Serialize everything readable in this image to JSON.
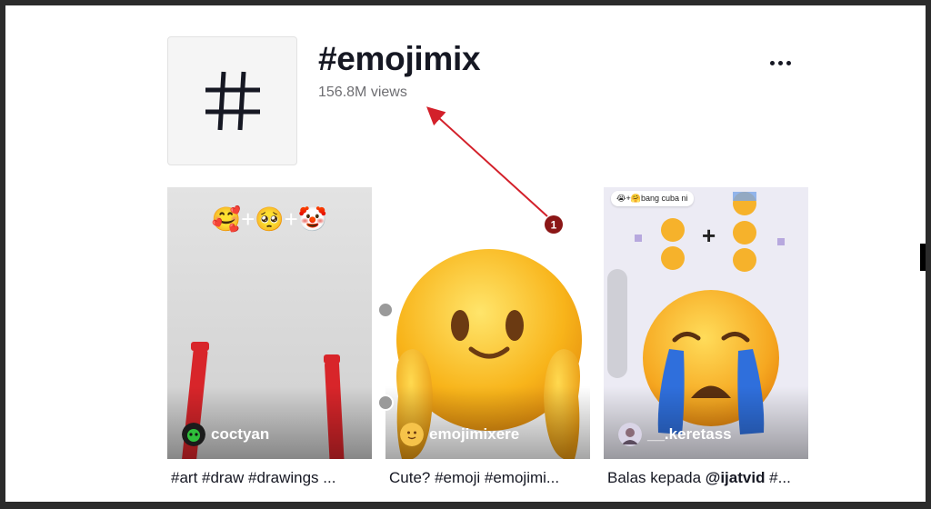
{
  "header": {
    "title": "#emojimix",
    "views": "156.8M views",
    "more_label": "..."
  },
  "annotation": {
    "marker": "1",
    "color": "#d3202a"
  },
  "videos": [
    {
      "author": "coctyan",
      "caption": "#art #draw #drawings ...",
      "overlay_text": "🥰+🥺+🤡"
    },
    {
      "author": "emojimixere",
      "caption": "Cute? #emoji #emojimi..."
    },
    {
      "author": "__.keretass",
      "caption_prefix": "Balas kepada ",
      "caption_mention": "@ijatvid",
      "caption_suffix": " #...",
      "bubble": "😭+🤗bang cuba ni"
    }
  ]
}
